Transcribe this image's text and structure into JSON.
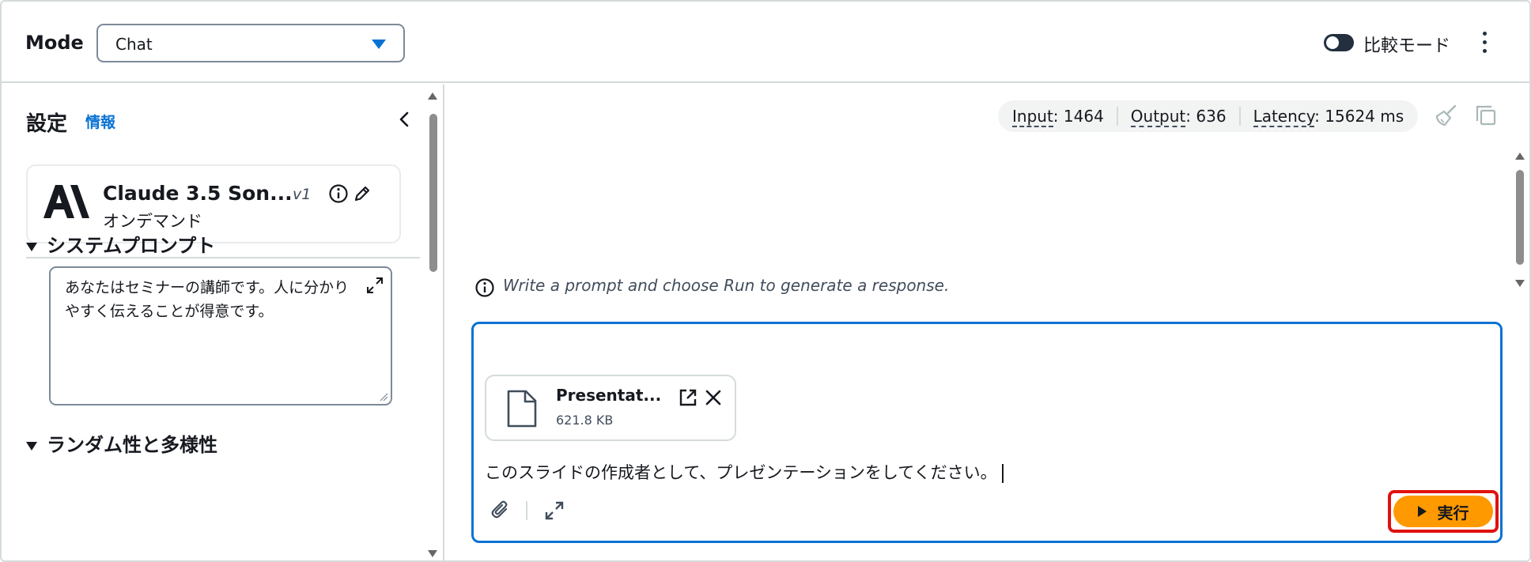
{
  "header": {
    "mode_label": "Mode",
    "mode_value": "Chat",
    "compare_label": "比較モード"
  },
  "settings": {
    "title": "設定",
    "info_link": "情報",
    "model": {
      "name": "Claude 3.5 Son...",
      "version": "v1",
      "subtitle": "オンデマンド"
    },
    "system_prompt": {
      "heading": "システムプロンプト",
      "text": "あなたはセミナーの講師です。人に分かりやすく伝えることが得意です。"
    },
    "randomness_heading": "ランダム性と多様性"
  },
  "stats": {
    "input_label": "Input",
    "input_value": ": 1464",
    "output_label": "Output",
    "output_value": ": 636",
    "latency_label": "Latency",
    "latency_value": ": 15624 ms"
  },
  "chat": {
    "hint": "Write a prompt and choose Run to generate a response."
  },
  "prompt": {
    "attachment": {
      "name": "Presentat...",
      "size": "621.8 KB"
    },
    "text": "このスライドの作成者として、プレゼンテーションをしてください。",
    "run_label": "実行"
  },
  "colors": {
    "accent": "#0972d3",
    "run_button": "#ff9900",
    "highlight": "#e0120f"
  }
}
